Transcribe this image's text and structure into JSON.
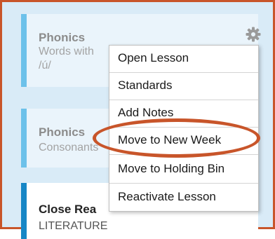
{
  "cards": [
    {
      "title": "Phonics",
      "lines": [
        "Words with",
        "/ú/"
      ]
    },
    {
      "title": "Phonics",
      "lines": [
        "Consonants"
      ]
    },
    {
      "title": "Close Rea",
      "lines": [
        "LITERATURE"
      ]
    }
  ],
  "menu": {
    "items": [
      "Open Lesson",
      "Standards",
      "Add Notes",
      "Move to New Week",
      "Move to Holding Bin",
      "Reactivate Lesson"
    ]
  },
  "icons": {
    "settings": "gear-icon"
  },
  "colors": {
    "highlight": "#c8552a",
    "accent": "#6cc1ea"
  }
}
